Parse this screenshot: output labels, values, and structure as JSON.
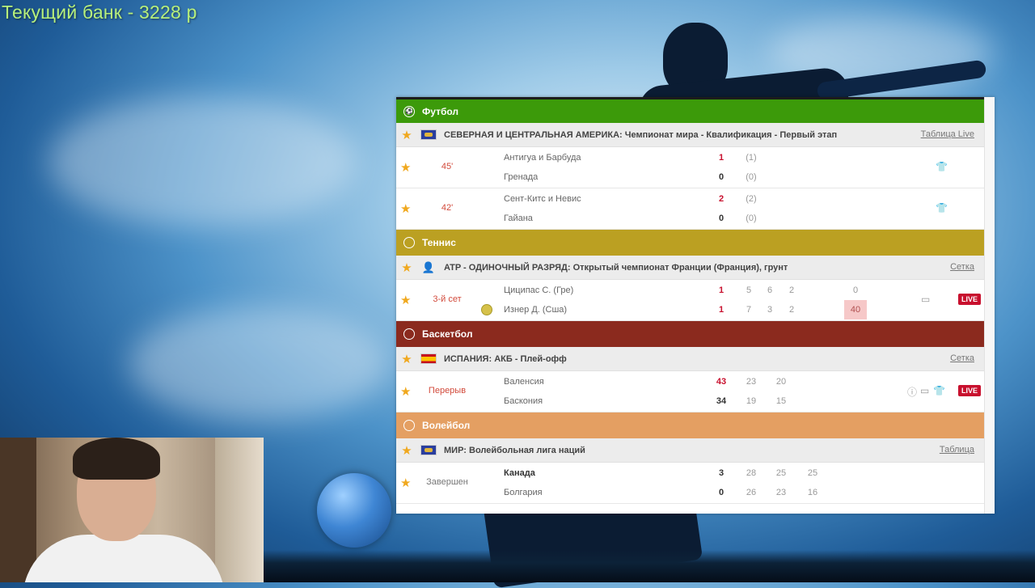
{
  "overlay": {
    "bank_text": "Текущий банк - 3228 р"
  },
  "panel": {
    "sections": {
      "football": {
        "title": "Футбол",
        "color": "#3c9a0a",
        "league": {
          "name": "СЕВЕРНАЯ И ЦЕНТРАЛЬНАЯ АМЕРИКА:",
          "desc": "Чемпионат мира - Квалификация - Первый этап",
          "link": "Таблица Live"
        },
        "matches": [
          {
            "time": "45'",
            "team1": "Антигуа и Барбуда",
            "team2": "Гренада",
            "score1": "1",
            "score2": "0",
            "half1": "(1)",
            "half2": "(0)"
          },
          {
            "time": "42'",
            "team1": "Сент-Китс и Невис",
            "team2": "Гайана",
            "score1": "2",
            "score2": "0",
            "half1": "(2)",
            "half2": "(0)"
          }
        ]
      },
      "tennis": {
        "title": "Теннис",
        "color": "#bba022",
        "league": {
          "name": "ATP - ОДИНОЧНЫЙ РАЗРЯД:",
          "desc": "Открытый чемпионат Франции (Франция), грунт",
          "link": "Сетка"
        },
        "match": {
          "time": "3-й сет",
          "team1": "Циципас С. (Гре)",
          "team2": "Изнер Д. (Сша)",
          "sets1": "1",
          "sets2": "1",
          "p1": [
            "5",
            "6",
            "2"
          ],
          "p2": [
            "7",
            "3",
            "2"
          ],
          "game1": "0",
          "game2": "40",
          "live": "LIVE"
        }
      },
      "basketball": {
        "title": "Баскетбол",
        "color": "#8b2a1e",
        "league": {
          "name": "ИСПАНИЯ:",
          "desc": "АКБ - Плей-офф",
          "link": "Сетка"
        },
        "match": {
          "time": "Перерыв",
          "team1": "Валенсия",
          "team2": "Баскония",
          "score1": "43",
          "score2": "34",
          "q1": [
            "23",
            "20"
          ],
          "q2": [
            "19",
            "15"
          ],
          "live": "LIVE"
        }
      },
      "volleyball": {
        "title": "Волейбол",
        "color": "#e49f62",
        "league": {
          "name": "МИР:",
          "desc": "Волейбольная лига наций",
          "link": "Таблица"
        },
        "match": {
          "time": "Завершен",
          "team1": "Канада",
          "team2": "Болгария",
          "score1": "3",
          "score2": "0",
          "s1": [
            "28",
            "25",
            "25"
          ],
          "s2": [
            "26",
            "23",
            "16"
          ]
        }
      }
    }
  }
}
